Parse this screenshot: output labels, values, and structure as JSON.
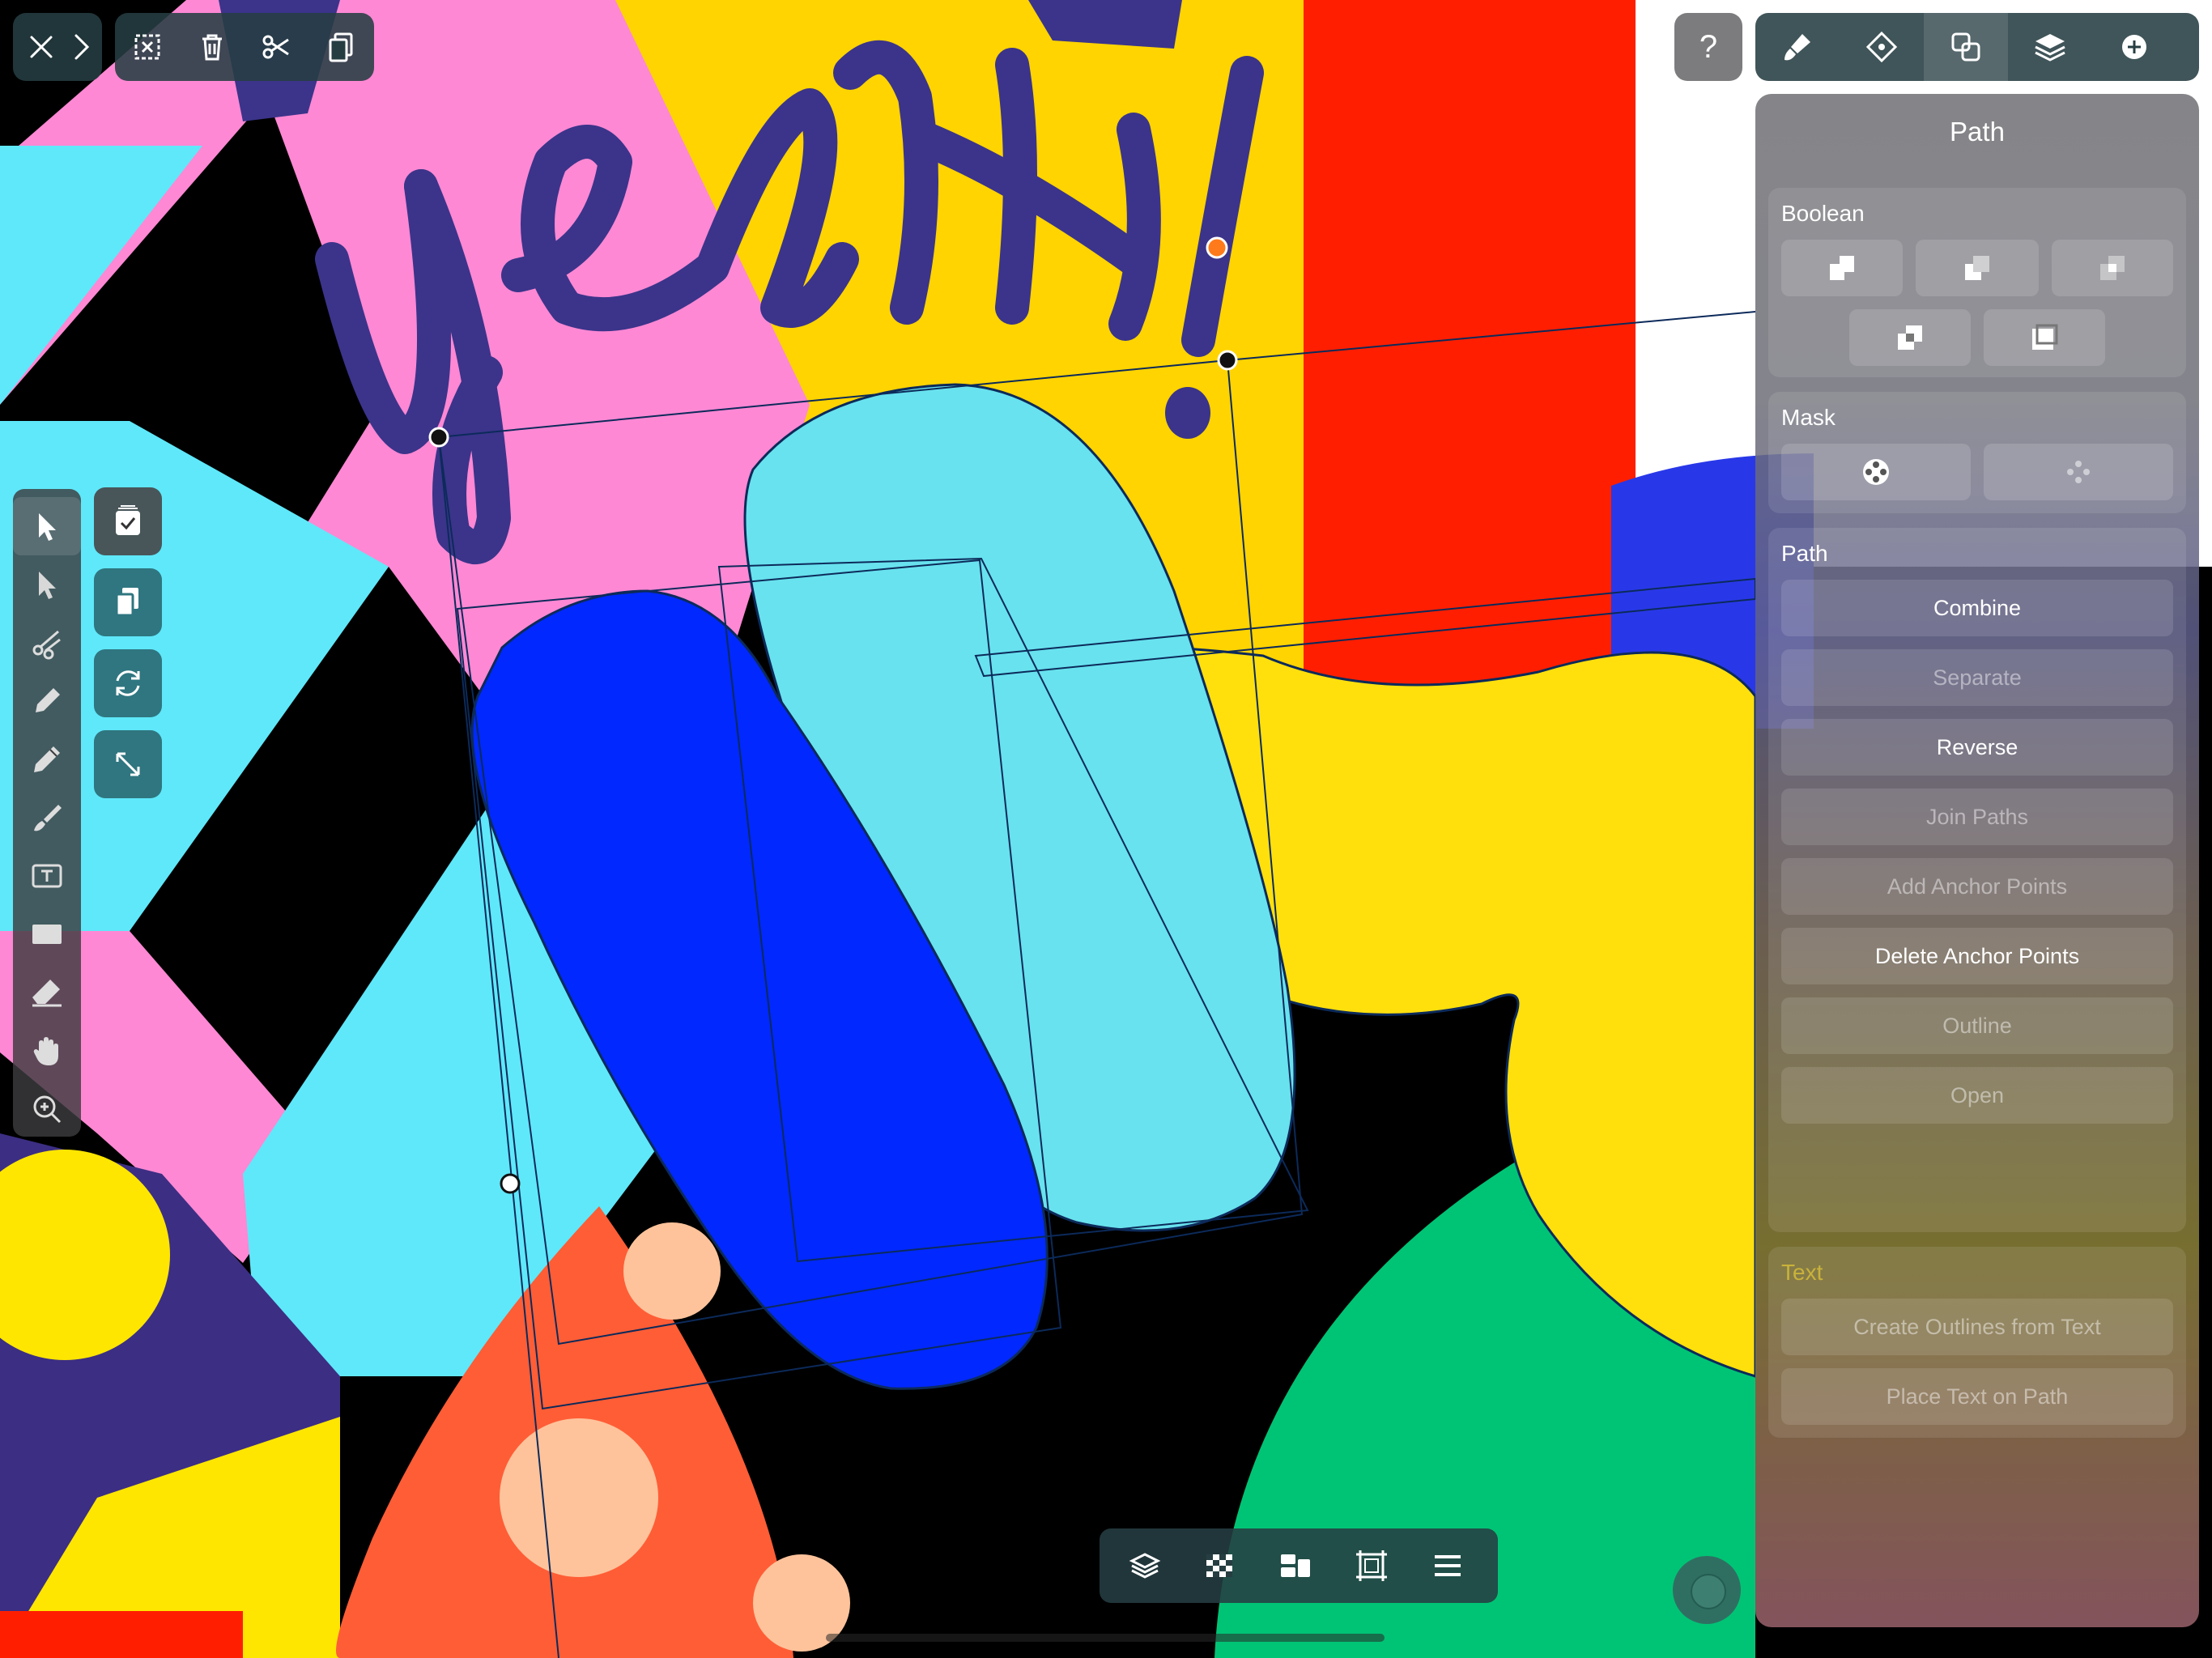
{
  "panel": {
    "title": "Path",
    "boolean_label": "Boolean",
    "mask_label": "Mask",
    "path_label": "Path",
    "path_buttons": [
      {
        "label": "Combine",
        "enabled": true
      },
      {
        "label": "Separate",
        "enabled": false
      },
      {
        "label": "Reverse",
        "enabled": true
      },
      {
        "label": "Join Paths",
        "enabled": false
      },
      {
        "label": "Add Anchor Points",
        "enabled": false
      },
      {
        "label": "Delete Anchor Points",
        "enabled": true
      },
      {
        "label": "Outline",
        "enabled": false
      },
      {
        "label": "Open",
        "enabled": false
      }
    ],
    "text_label": "Text",
    "text_buttons": [
      {
        "label": "Create Outlines from Text",
        "enabled": false
      },
      {
        "label": "Place Text on Path",
        "enabled": false
      }
    ]
  },
  "help": {
    "label": "?"
  },
  "colors": {
    "accent": "#2f7680",
    "panel_bg": "#6e6e74",
    "text_section": "#c9b23a"
  },
  "icons": {
    "top_left": [
      "close-icon",
      "chevron-right-icon",
      "deselect-icon",
      "trash-icon",
      "scissors-icon",
      "copy-icon"
    ],
    "top_right": [
      "brush-settings-icon",
      "node-icon",
      "path-ops-icon",
      "layers-icon",
      "add-icon"
    ],
    "left_tools": [
      "select-arrow-icon",
      "direct-select-icon",
      "scissors-tool-icon",
      "pen-icon",
      "pencil-icon",
      "brush-icon",
      "text-tool-icon",
      "rectangle-icon",
      "eraser-icon",
      "hand-icon",
      "zoom-icon"
    ],
    "bottom": [
      "layers-icon",
      "checkerboard-icon",
      "arrange-icon",
      "artboard-icon",
      "menu-icon"
    ]
  }
}
